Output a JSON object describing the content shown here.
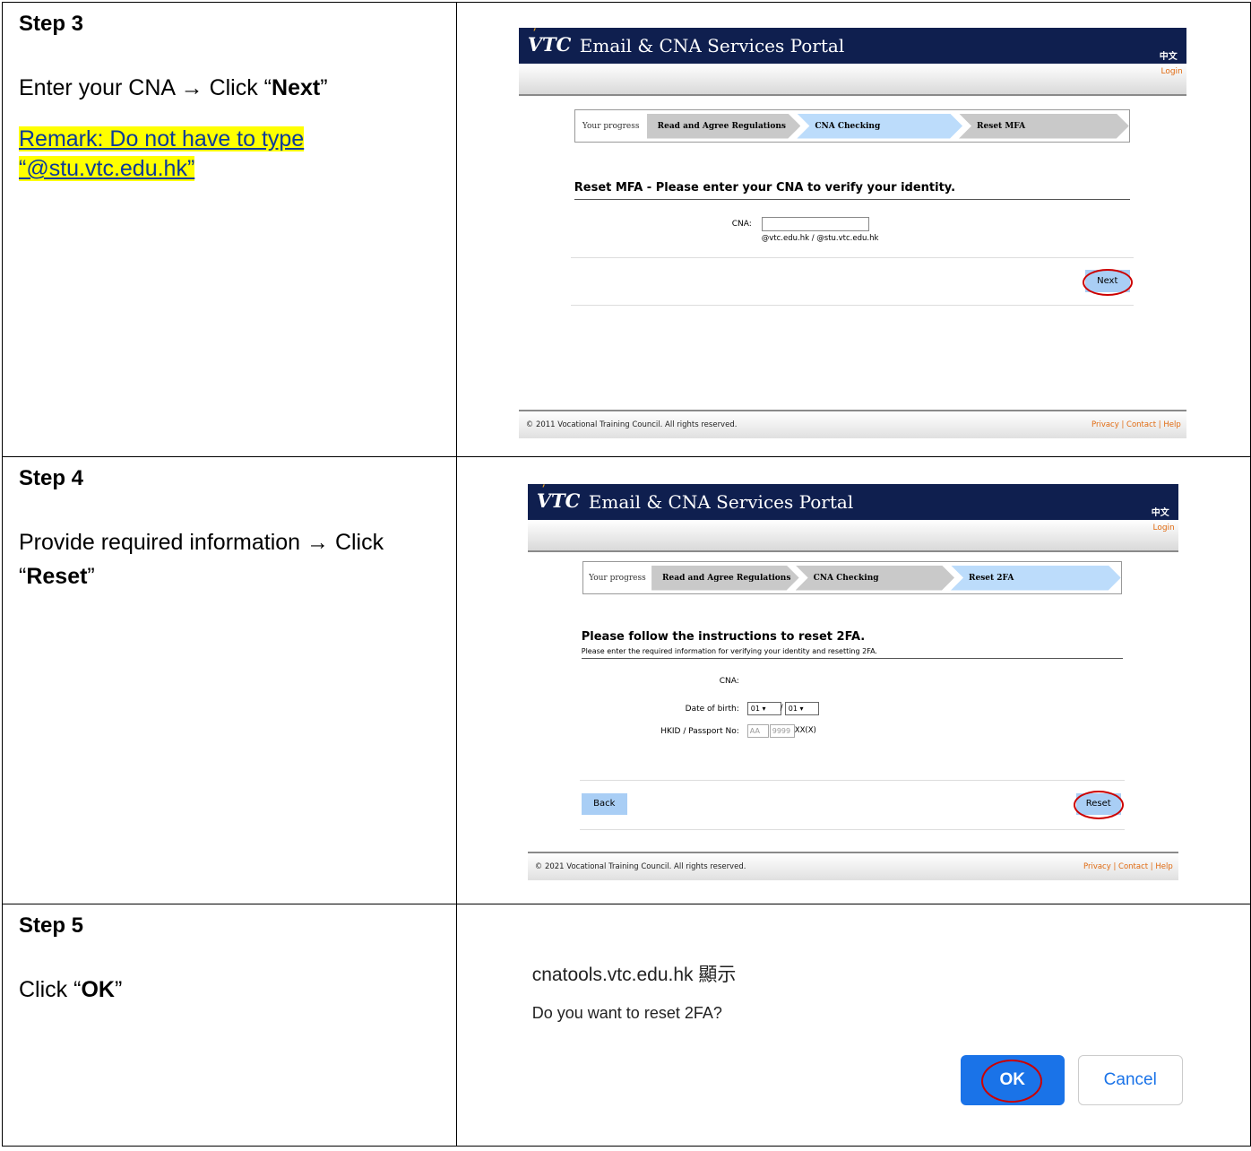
{
  "steps": [
    {
      "title": "Step 3",
      "instruction_pre": "Enter your CNA → Click “",
      "instruction_bold": "Next",
      "instruction_post": "”",
      "remark_line1": "Remark: Do not have to type",
      "remark_line2": "“@stu.vtc.edu.hk”"
    },
    {
      "title": "Step 4",
      "instruction_pre": "Provide required information → Click “",
      "instruction_bold": "Reset",
      "instruction_post": "”"
    },
    {
      "title": "Step 5",
      "instruction_pre": "Click “",
      "instruction_bold": "OK",
      "instruction_post": "”"
    }
  ],
  "portal": {
    "logo": "VTC",
    "title": "Email & CNA Services Portal",
    "lang": "中文",
    "login": "Login",
    "progress_label": "Your progress",
    "step1": "Read and Agree Regulations",
    "step2": "CNA Checking"
  },
  "screen3": {
    "step3": "Reset MFA",
    "heading": "Reset MFA - Please enter your CNA to verify your identity.",
    "cna_label": "CNA:",
    "cna_value": "",
    "domain_hint": "@vtc.edu.hk / @stu.vtc.edu.hk",
    "next_button": "Next",
    "copyright": "© 2011 Vocational Training Council. All rights reserved.",
    "footer_links": "Privacy | Contact | Help"
  },
  "screen4": {
    "step3": "Reset 2FA",
    "heading": "Please follow the instructions to reset 2FA.",
    "subheading": "Please enter the required information for verifying your identity and resetting 2FA.",
    "cna_label": "CNA:",
    "dob_label": "Date of birth:",
    "dob_day": "01",
    "dob_month": "01",
    "hkid_label": "HKID / Passport No:",
    "hkid_prefix_placeholder": "AA",
    "hkid_digits_placeholder": "9999",
    "hkid_suffix": "XX(X)",
    "back_button": "Back",
    "reset_button": "Reset",
    "copyright": "© 2021 Vocational Training Council. All rights reserved.",
    "footer_links": "Privacy | Contact | Help"
  },
  "dialog": {
    "origin": "cnatools.vtc.edu.hk 顯示",
    "message": "Do you want to reset 2FA?",
    "ok": "OK",
    "cancel": "Cancel"
  },
  "colors": {
    "header_bg": "#0f1f4f",
    "button_blue": "#a9cef5",
    "highlight": "#ffff00",
    "circle_red": "#cc0000",
    "dialog_ok": "#1a73e8"
  }
}
